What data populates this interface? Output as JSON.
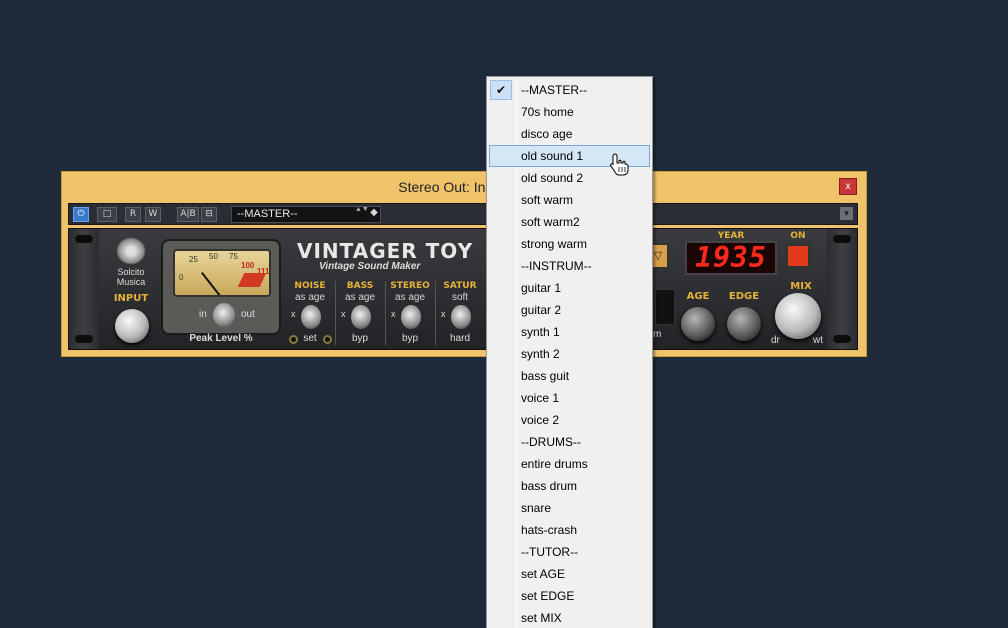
{
  "window": {
    "title": "Stereo Out: Ins. 1 - V",
    "close_label": "x"
  },
  "toolbar": {
    "power": "⏻",
    "bypass": "□",
    "read": "R",
    "write": "W",
    "ab": "A|B",
    "copy": "⊟",
    "preset": "--MASTER--",
    "spin": "▲▼",
    "save": "◆",
    "menu": "▼"
  },
  "plugin": {
    "brand_line1": "Solcito",
    "brand_line2": "Musica",
    "input_label": "INPUT",
    "meter_scale": [
      "0",
      "25",
      "50",
      "75",
      "100",
      "111"
    ],
    "io_in": "in",
    "io_out": "out",
    "peak_label": "Peak Level %",
    "title": "VINTAGER TOY",
    "subtitle": "Vintage Sound Maker",
    "sections": [
      {
        "label": "NOISE",
        "value": "as age",
        "bottom": "set"
      },
      {
        "label": "BASS",
        "value": "as age",
        "bottom": "byp"
      },
      {
        "label": "STEREO",
        "value": "as age",
        "bottom": "byp"
      },
      {
        "label": "SATUR",
        "value": "soft",
        "bottom": "hard"
      }
    ],
    "x_label": "x",
    "year_label": "YEAR",
    "year_value": "1935",
    "on_label": "ON",
    "age_label": "AGE",
    "edge_label": "EDGE",
    "mix_label": "MIX",
    "mix_dry": "dr",
    "mix_wet": "wt",
    "m_text": "m",
    "amber_btn": "▽"
  },
  "menu": {
    "check": "✔",
    "highlighted_index": 3,
    "items": [
      "--MASTER--",
      "70s home",
      "disco age",
      "old sound 1",
      "old sound 2",
      "soft warm",
      "soft warm2",
      "strong warm",
      "--INSTRUM--",
      "guitar 1",
      "guitar 2",
      "synth 1",
      "synth 2",
      "bass guit",
      "voice 1",
      "voice 2",
      "--DRUMS--",
      "entire drums",
      "bass drum",
      "snare",
      "hats-crash",
      "--TUTOR--",
      "set AGE",
      "set EDGE",
      "set MIX"
    ]
  },
  "colors": {
    "desktop": "#1e2a3a",
    "window_frame": "#f0c36a",
    "accent_yellow": "#e5b23a",
    "led_red": "#ff2a1a",
    "menu_highlight": "#d5e6f7"
  }
}
